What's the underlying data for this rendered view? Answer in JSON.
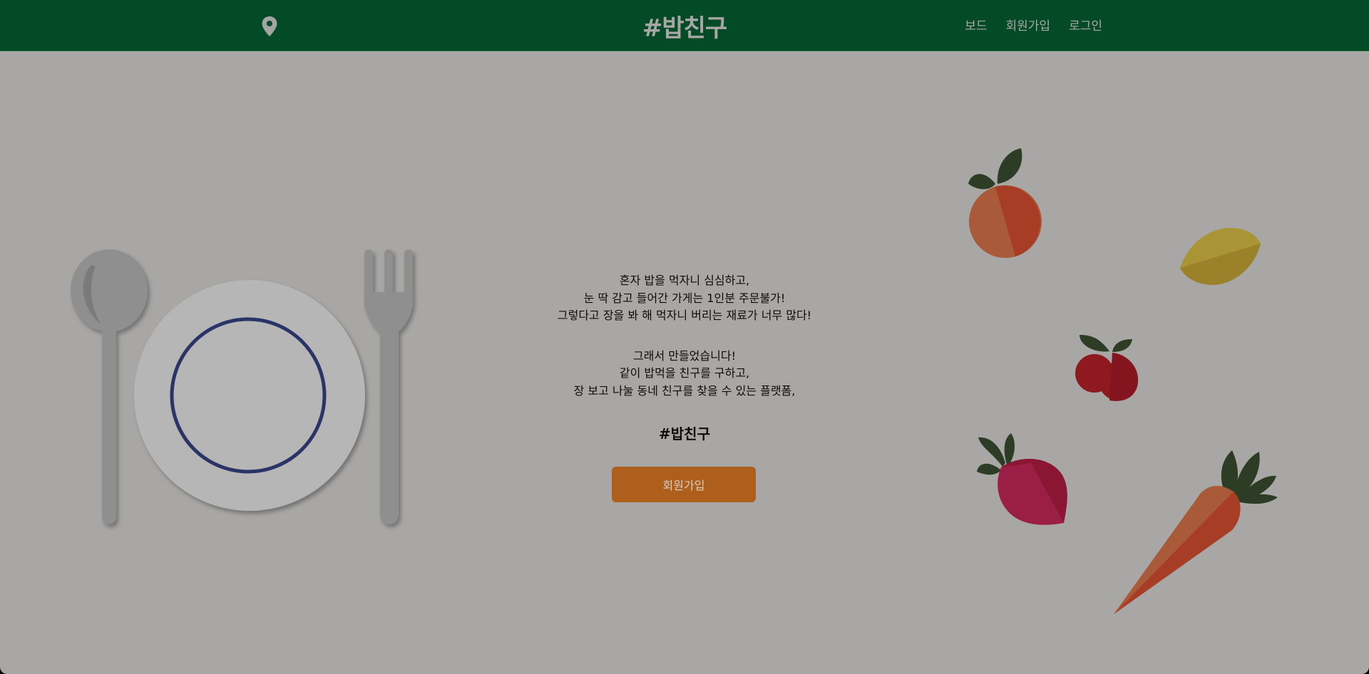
{
  "header": {
    "logo": "#밥친구",
    "nav": [
      {
        "label": "보드"
      },
      {
        "label": "회원가입"
      },
      {
        "label": "로그인"
      }
    ]
  },
  "hero": {
    "lines1": [
      "혼자 밥을 먹자니 심심하고,",
      "눈 딱 감고 들어간 가게는 1인분 주문불가!",
      "그렇다고 장을 봐 해 먹자니 버리는 재료가 너무 많다!"
    ],
    "lines2": [
      "그래서 만들었습니다!",
      "같이 밥먹을 친구를 구하고,",
      "장 보고 나눌 동네 친구를 찾을 수 있는 플랫폼,"
    ],
    "brand": "#밥친구",
    "cta": "회원가입"
  },
  "icons": {
    "location": "location-pin-icon"
  },
  "colors": {
    "header_bg": "#034a26",
    "page_bg": "#a8a7a5",
    "cta_bg": "#ad5f1b",
    "plate_ring": "#2a3466"
  }
}
